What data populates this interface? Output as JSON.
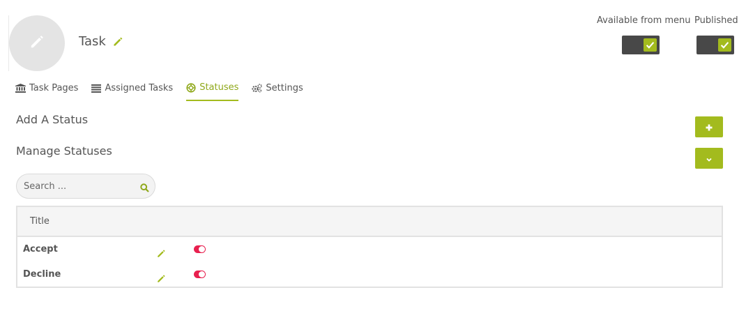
{
  "header": {
    "title": "Task",
    "toggles": [
      {
        "label": "Available from menu",
        "checked": true
      },
      {
        "label": "Published",
        "checked": true
      }
    ]
  },
  "tabs": [
    {
      "label": "Task Pages",
      "icon": "bank-icon",
      "active": false
    },
    {
      "label": "Assigned Tasks",
      "icon": "list-icon",
      "active": false
    },
    {
      "label": "Statuses",
      "icon": "lifebuoy-icon",
      "active": true
    },
    {
      "label": "Settings",
      "icon": "gears-icon",
      "active": false
    }
  ],
  "sections": {
    "add_status": "Add A Status",
    "manage_statuses": "Manage Statuses"
  },
  "search": {
    "placeholder": "Search ...",
    "value": ""
  },
  "table": {
    "columns": [
      "Title"
    ],
    "rows": [
      {
        "title": "Accept",
        "enabled": true
      },
      {
        "title": "Decline",
        "enabled": true
      }
    ]
  },
  "colors": {
    "accent": "#a3bb1e",
    "toggle_on": "#e8204f",
    "switch_bg": "#484848"
  }
}
